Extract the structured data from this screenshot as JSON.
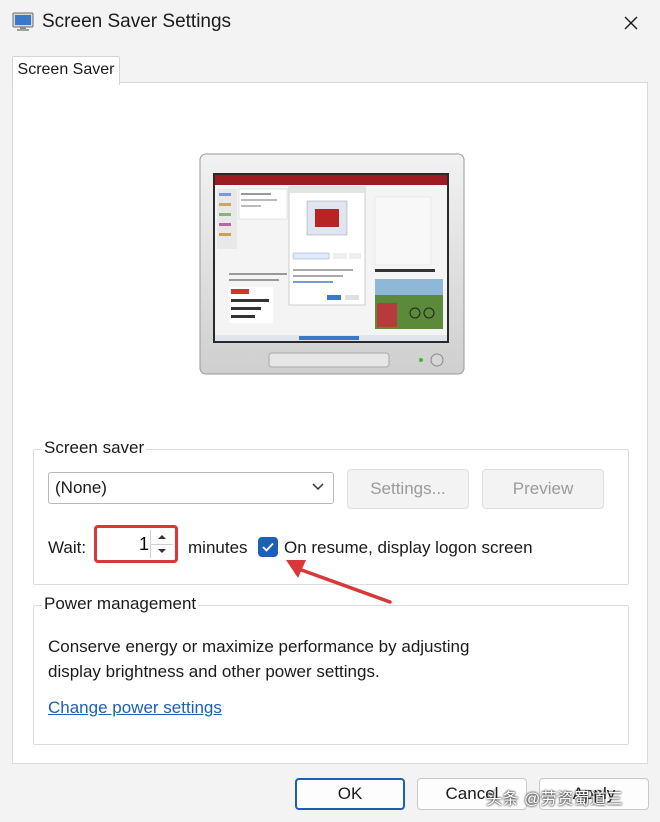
{
  "window": {
    "title": "Screen Saver Settings",
    "tab_label": "Screen Saver"
  },
  "screen_saver": {
    "group_label": "Screen saver",
    "selected": "(None)",
    "settings_label": "Settings...",
    "preview_label": "Preview",
    "wait_label": "Wait:",
    "wait_value": "1",
    "minutes_label": "minutes",
    "resume_checked": true,
    "resume_label": "On resume, display logon screen"
  },
  "power": {
    "group_label": "Power management",
    "description_line1": "Conserve energy or maximize performance by adjusting",
    "description_line2": "display brightness and other power settings.",
    "link_label": "Change power settings"
  },
  "footer": {
    "ok_label": "OK",
    "cancel_label": "Cancel",
    "apply_label": "Apply"
  },
  "watermark": "头条 @劳资蜀道三",
  "colors": {
    "accent": "#1d5fb4",
    "highlight_red": "#d9383a"
  }
}
